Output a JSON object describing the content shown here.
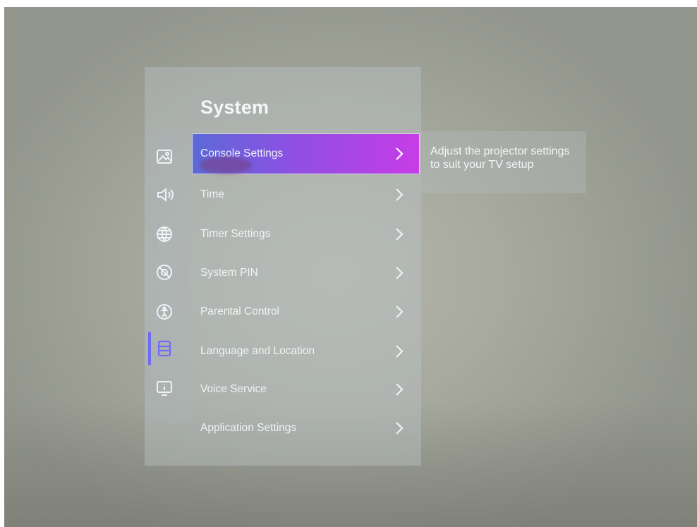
{
  "menu": {
    "title": "System",
    "items": [
      {
        "label": "Console Settings",
        "focused": true
      },
      {
        "label": "Time"
      },
      {
        "label": "Timer Settings"
      },
      {
        "label": "System PIN"
      },
      {
        "label": "Parental Control"
      },
      {
        "label": "Language and Location"
      },
      {
        "label": "Voice Service"
      },
      {
        "label": "Application Settings"
      }
    ]
  },
  "description": "Adjust the projector settings to suit your TV setup",
  "sidebar": {
    "icons": [
      "picture-icon",
      "sound-icon",
      "network-globe-icon",
      "no-disturb-icon",
      "accessibility-icon",
      "system-icon",
      "support-info-icon"
    ],
    "active": "system-icon",
    "accent_color": "#6f6cf2"
  },
  "colors": {
    "focus_gradient_start": "#5c6ad8",
    "focus_gradient_end": "#c73ce7"
  }
}
